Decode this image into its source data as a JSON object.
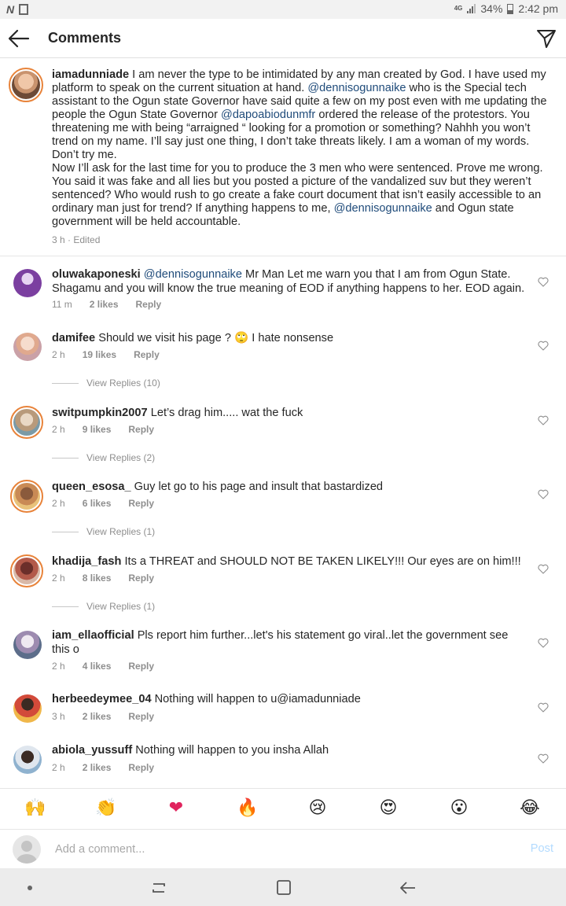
{
  "status_bar": {
    "network": "4G",
    "battery": "34%",
    "time": "2:42 pm"
  },
  "header": {
    "title": "Comments"
  },
  "caption": {
    "username": "iamadunniade",
    "segments": [
      " I am never the type to be intimidated by any man created by God. I have used my platform to speak on the current situation at hand. ",
      "@dennisogunnaike",
      " who is the Special tech assistant to the Ogun state Governor have said quite a few on my post even with me updating the people the Ogun State Governor ",
      "@dapoabiodunmfr",
      " ordered the release of the protestors. You threatening  me with being “arraigned “ looking for a promotion or something? Nahhh you won’t trend on my name. I’ll say just one thing, I don’t take threats likely. I am a woman of my words. Don’t try me.",
      "Now I’ll ask for the last time for you to produce the 3 men who were sentenced. Prove me wrong. You said it was fake and all lies but you posted a picture of the vandalized suv but they weren’t sentenced? Who would rush to go create a fake court document that isn’t easily accessible to an ordinary man just for trend? If anything happens to me, ",
      "@dennisogunnaike",
      " and Ogun state government will be held accountable."
    ],
    "meta": "3 h · Edited"
  },
  "comments": [
    {
      "username": "oluwakaponeski",
      "mention": "@dennisogunnaike",
      "text": " Mr Man  Let me warn you that I am from Ogun State. Shagamu and you will know the true meaning of EOD if anything happens to her.  EOD again.",
      "time": "11 m",
      "likes": "2 likes",
      "reply": "Reply",
      "view_replies": ""
    },
    {
      "username": "damifee",
      "mention": "",
      "text": " Should we visit his page ? 🙄 I hate nonsense",
      "time": "2 h",
      "likes": "19 likes",
      "reply": "Reply",
      "view_replies": "View Replies (10)"
    },
    {
      "username": "switpumpkin2007",
      "mention": "",
      "text": " Let’s drag him..... wat the fuck",
      "time": "2 h",
      "likes": "9 likes",
      "reply": "Reply",
      "view_replies": "View Replies (2)"
    },
    {
      "username": "queen_esosa_",
      "mention": "",
      "text": " Guy let go to his page and insult that bastardized",
      "time": "2 h",
      "likes": "6 likes",
      "reply": "Reply",
      "view_replies": "View Replies (1)"
    },
    {
      "username": "khadija_fash",
      "mention": "",
      "text": " Its a THREAT and SHOULD NOT BE TAKEN LIKELY!!! Our eyes are on him!!!",
      "time": "2 h",
      "likes": "8 likes",
      "reply": "Reply",
      "view_replies": "View Replies (1)"
    },
    {
      "username": "iam_ellaofficial",
      "mention": "",
      "text": " Pls report him further...let's his statement go viral..let the government see this o",
      "time": "2 h",
      "likes": "4 likes",
      "reply": "Reply",
      "view_replies": ""
    },
    {
      "username": "herbeedeymee_04",
      "mention": "",
      "text": " Nothing will happen to u@iamadunniade",
      "time": "3 h",
      "likes": "2 likes",
      "reply": "Reply",
      "view_replies": ""
    },
    {
      "username": "abiola_yussuff",
      "mention": "",
      "text": " Nothing will happen to you insha Allah",
      "time": "2 h",
      "likes": "2 likes",
      "reply": "Reply",
      "view_replies": ""
    }
  ],
  "emoji_bar": [
    "🙌",
    "👏",
    "❤",
    "🔥",
    "😢",
    "😍",
    "😮",
    "😂"
  ],
  "comment_input": {
    "placeholder": "Add a comment...",
    "post_label": "Post"
  },
  "colors": {
    "mention": "#1f4b7a",
    "meta": "#8e8e8e",
    "post_disabled": "#b3dbff",
    "story_ring": "#e8833a"
  }
}
